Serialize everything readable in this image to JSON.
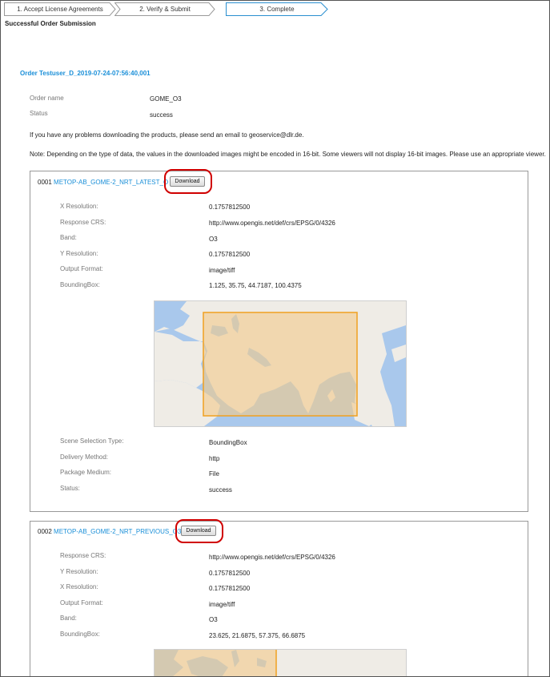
{
  "steps": [
    {
      "label": "1. Accept License Agreements",
      "active": false
    },
    {
      "label": "2. Verify & Submit",
      "active": false
    },
    {
      "label": "3. Complete",
      "active": true
    }
  ],
  "page_title": "Successful Order Submission",
  "order": {
    "id": "Order Testuser_D_2019-07-24-07:56:40,001",
    "name_label": "Order name",
    "name_value": "GOME_O3",
    "status_label": "Status",
    "status_value": "success"
  },
  "notes": {
    "problems": "If you have any problems downloading the products, please send an email to geoservice@dlr.de.",
    "encoding": "Note: Depending on the type of data, the values in the downloaded images might be encoded in 16-bit. Some viewers will not display 16-bit images. Please use an appropriate viewer."
  },
  "items": [
    {
      "number": "0001",
      "product": "METOP-AB_GOME-2_NRT_LATEST_O",
      "download_label": "Download",
      "fields": [
        {
          "label": "X Resolution:",
          "value": "0.1757812500"
        },
        {
          "label": "Response CRS:",
          "value": "http://www.opengis.net/def/crs/EPSG/0/4326"
        },
        {
          "label": "Band:",
          "value": "O3"
        },
        {
          "label": "Y Resolution:",
          "value": "0.1757812500"
        },
        {
          "label": "Output Format:",
          "value": "image/tiff"
        },
        {
          "label": "BoundingBox:",
          "value": "1.125, 35.75, 44.7187, 100.4375"
        }
      ],
      "fields2": [
        {
          "label": "Scene Selection Type:",
          "value": "BoundingBox"
        },
        {
          "label": "Delivery Method:",
          "value": "http"
        },
        {
          "label": "Package Medium:",
          "value": "File"
        },
        {
          "label": "Status:",
          "value": "success"
        }
      ]
    },
    {
      "number": "0002",
      "product": "METOP-AB_GOME-2_NRT_PREVIOUS_O3",
      "download_label": "Download",
      "fields": [
        {
          "label": "Response CRS:",
          "value": "http://www.opengis.net/def/crs/EPSG/0/4326"
        },
        {
          "label": "Y Resolution:",
          "value": "0.1757812500"
        },
        {
          "label": "X Resolution:",
          "value": "0.1757812500"
        },
        {
          "label": "Output Format:",
          "value": "image/tiff"
        },
        {
          "label": "Band:",
          "value": "O3"
        },
        {
          "label": "BoundingBox:",
          "value": "23.625, 21.6875, 57.375, 66.6875"
        }
      ]
    }
  ],
  "colors": {
    "link": "#1a8fd8",
    "highlight": "#d00000",
    "bbox_fill": "#f2c98a",
    "bbox_stroke": "#f0a020",
    "water": "#a9c8ec",
    "land": "#efece6"
  }
}
